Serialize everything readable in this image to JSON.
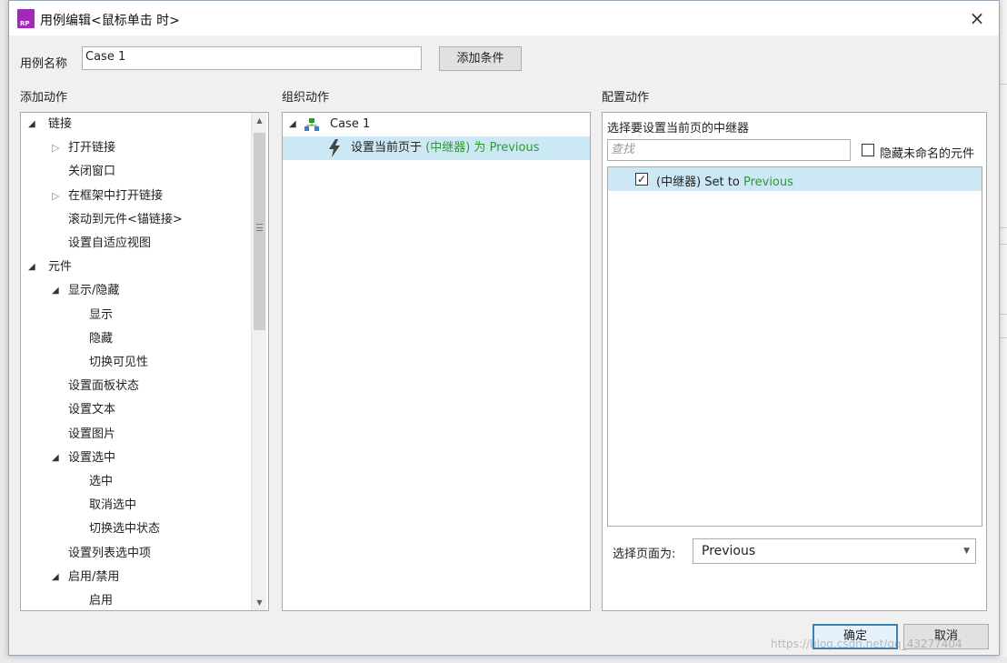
{
  "window": {
    "title": "用例编辑<鼠标单击 时>",
    "close_icon": "×",
    "app_icon_text": "RP"
  },
  "case_name": {
    "label": "用例名称",
    "value": "Case 1",
    "add_condition_button": "添加条件"
  },
  "add_actions": {
    "header": "添加动作",
    "items": [
      {
        "label": "链接",
        "level": 0,
        "expander": "open"
      },
      {
        "label": "打开链接",
        "level": 1,
        "expander": "closed"
      },
      {
        "label": "关闭窗口",
        "level": 1,
        "expander": "none"
      },
      {
        "label": "在框架中打开链接",
        "level": 1,
        "expander": "closed"
      },
      {
        "label": "滚动到元件<锚链接>",
        "level": 1,
        "expander": "none"
      },
      {
        "label": "设置自适应视图",
        "level": 1,
        "expander": "none"
      },
      {
        "label": "元件",
        "level": 0,
        "expander": "open"
      },
      {
        "label": "显示/隐藏",
        "level": 1,
        "expander": "open"
      },
      {
        "label": "显示",
        "level": 2,
        "expander": "none"
      },
      {
        "label": "隐藏",
        "level": 2,
        "expander": "none"
      },
      {
        "label": "切换可见性",
        "level": 2,
        "expander": "none"
      },
      {
        "label": "设置面板状态",
        "level": 1,
        "expander": "none"
      },
      {
        "label": "设置文本",
        "level": 1,
        "expander": "none"
      },
      {
        "label": "设置图片",
        "level": 1,
        "expander": "none"
      },
      {
        "label": "设置选中",
        "level": 1,
        "expander": "open"
      },
      {
        "label": "选中",
        "level": 2,
        "expander": "none"
      },
      {
        "label": "取消选中",
        "level": 2,
        "expander": "none"
      },
      {
        "label": "切换选中状态",
        "level": 2,
        "expander": "none"
      },
      {
        "label": "设置列表选中项",
        "level": 1,
        "expander": "none"
      },
      {
        "label": "启用/禁用",
        "level": 1,
        "expander": "open"
      },
      {
        "label": "启用",
        "level": 2,
        "expander": "none"
      }
    ]
  },
  "organize_actions": {
    "header": "组织动作",
    "case_label": "Case 1",
    "action": {
      "prefix": "设置当前页于 ",
      "target": "(中继器)",
      "middle": " 为 ",
      "value": "Previous"
    }
  },
  "configure_action": {
    "header": "配置动作",
    "subheader": "选择要设置当前页的中继器",
    "search_placeholder": "查找",
    "hide_unnamed_label": "隐藏未命名的元件",
    "repeater_row": {
      "checked": true,
      "text": "(中继器) Set to ",
      "value": "Previous"
    },
    "select_page_label": "选择页面为:",
    "select_page_value": "Previous"
  },
  "footer": {
    "ok_button": "确定",
    "cancel_button": "取消"
  },
  "watermark": "https://blog.csdn.net/qq_43277404",
  "colors": {
    "accent_green": "#2e9a2e",
    "selection": "#cce8f4",
    "app_icon": "#a32ab8"
  }
}
